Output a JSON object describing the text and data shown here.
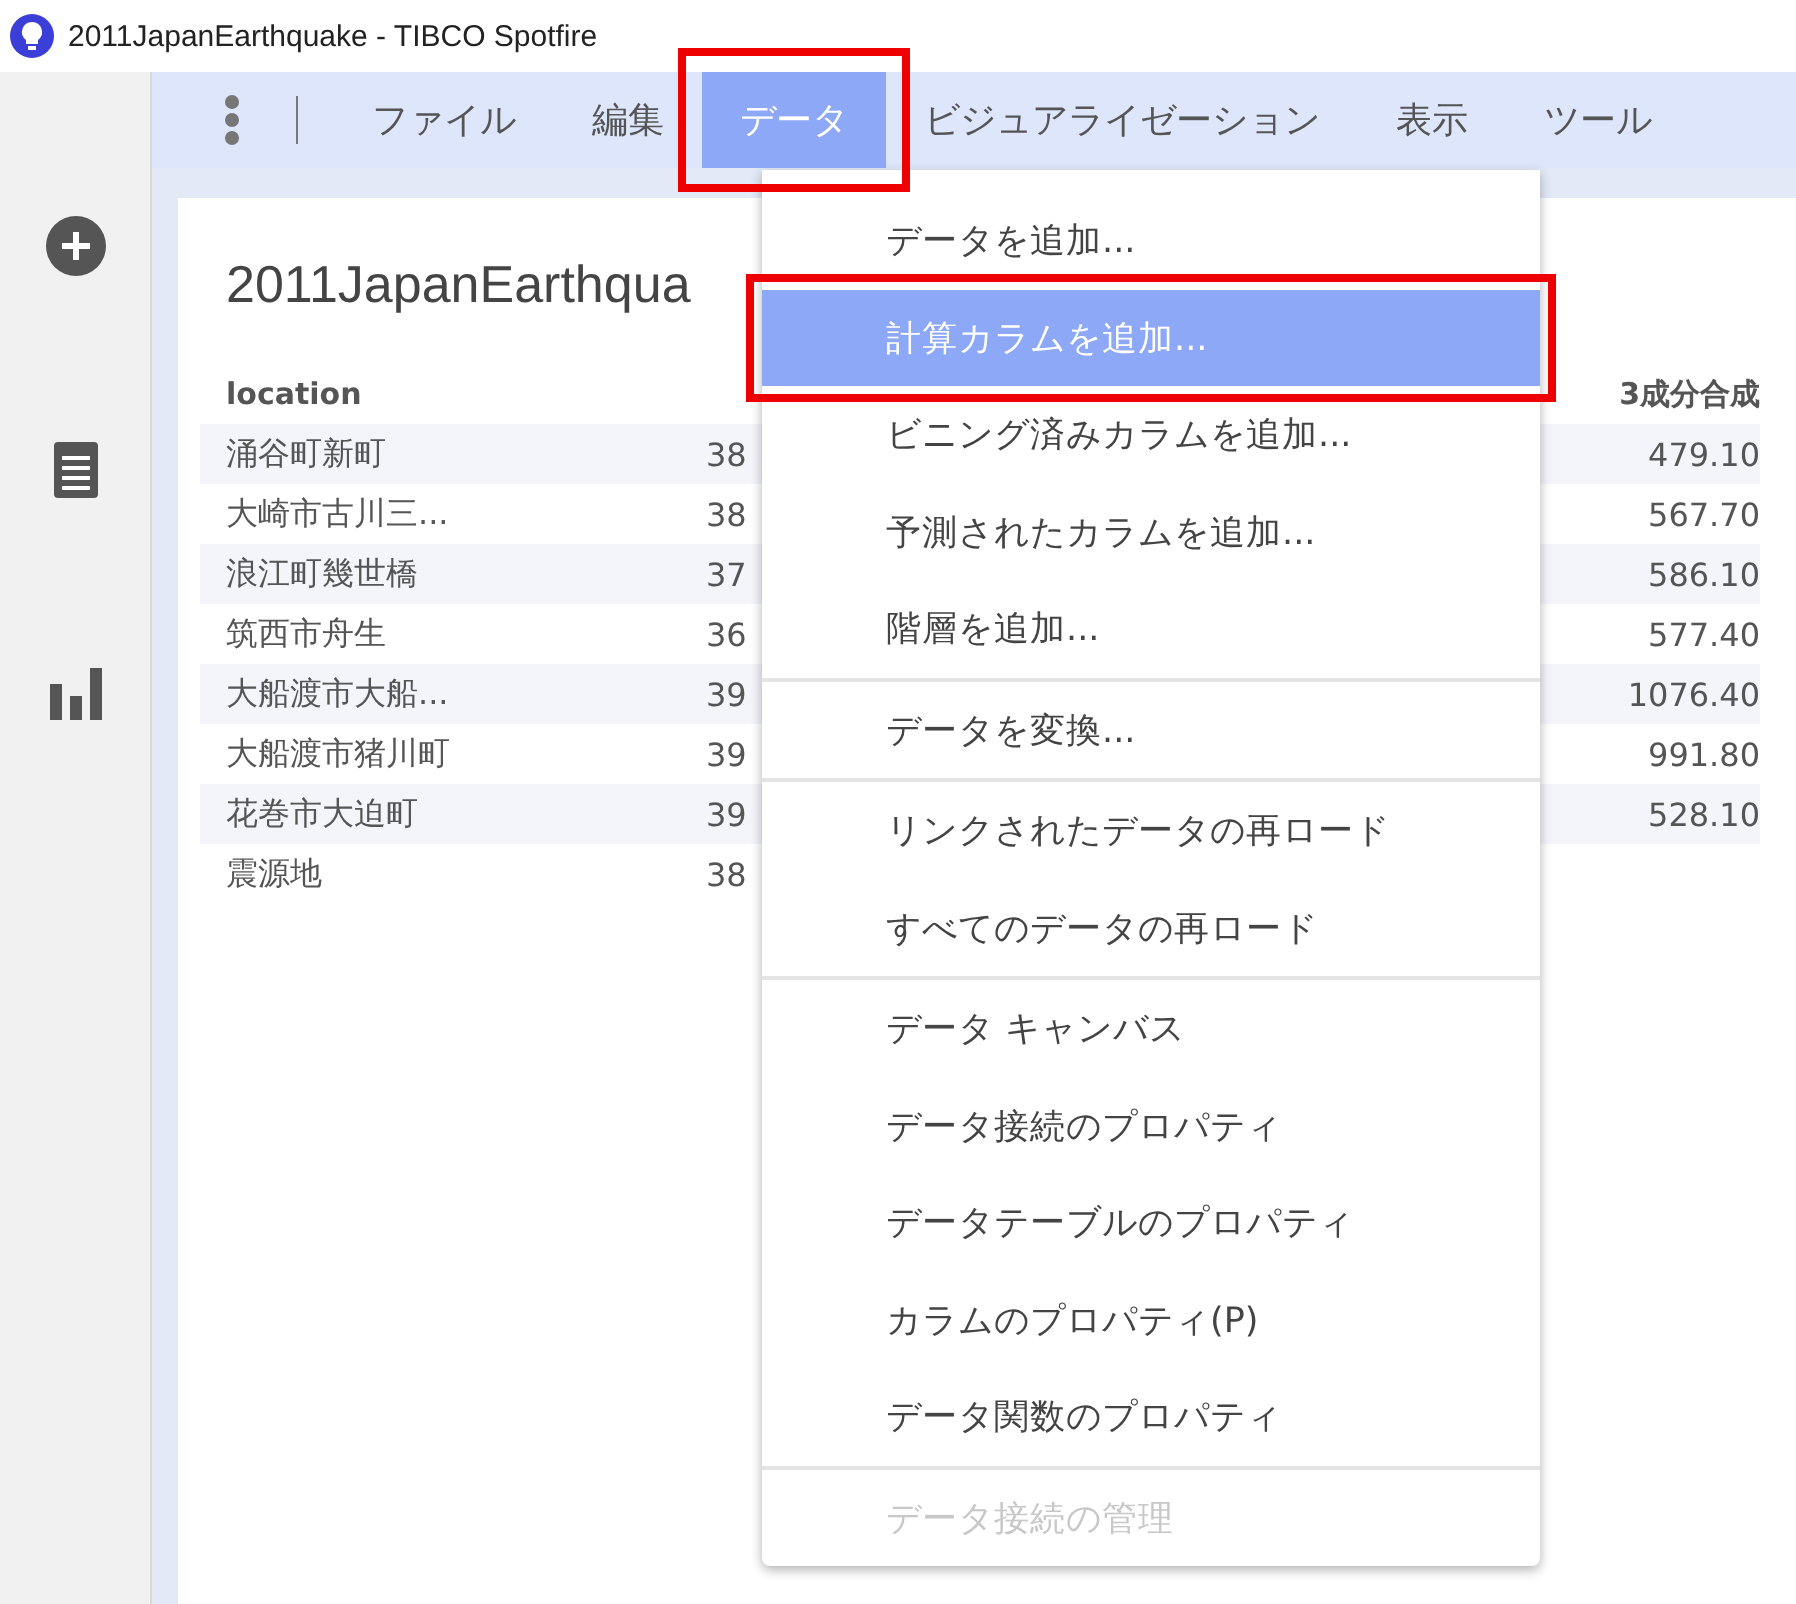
{
  "window": {
    "title": "2011JapanEarthquake - TIBCO Spotfire"
  },
  "menu_bar": [
    {
      "label": "ファイル",
      "selected": false,
      "highlighted": false
    },
    {
      "label": "編集",
      "selected": false,
      "highlighted": false
    },
    {
      "label": "データ",
      "selected": true,
      "highlighted": true
    },
    {
      "label": "ビジュアライゼーション",
      "selected": false,
      "highlighted": false
    },
    {
      "label": "表示",
      "selected": false,
      "highlighted": false
    },
    {
      "label": "ツール",
      "selected": false,
      "highlighted": false
    }
  ],
  "visualization": {
    "title": "2011JapanEarthqua",
    "columns": [
      "location",
      "3成分合成"
    ],
    "rows": [
      {
        "location": "涌谷町新町",
        "column_2": "38",
        "value": "479.10"
      },
      {
        "location": "大崎市古川三...",
        "column_2": "38",
        "value": "567.70"
      },
      {
        "location": "浪江町幾世橋",
        "column_2": "37",
        "value": "586.10"
      },
      {
        "location": "筑西市舟生",
        "column_2": "36",
        "value": "577.40"
      },
      {
        "location": "大船渡市大船...",
        "column_2": "39",
        "value": "1076.40"
      },
      {
        "location": "大船渡市猪川町",
        "column_2": "39",
        "value": "991.80"
      },
      {
        "location": "花巻市大迫町",
        "column_2": "39",
        "value": "528.10"
      },
      {
        "location": "震源地",
        "column_2": "38"
      }
    ]
  },
  "dropdown_menu": [
    [
      {
        "label": "データを追加...",
        "selected": false,
        "highlighted": false,
        "disabled": false
      },
      {
        "label": "計算カラムを追加...",
        "selected": true,
        "highlighted": true,
        "disabled": false
      },
      {
        "label": "ビニング済みカラムを追加...",
        "selected": false,
        "highlighted": false,
        "disabled": false
      },
      {
        "label": "予測されたカラムを追加...",
        "selected": false,
        "highlighted": false,
        "disabled": false
      },
      {
        "label": "階層を追加...",
        "selected": false,
        "highlighted": false,
        "disabled": false
      }
    ],
    [
      {
        "label": "データを変換...",
        "selected": false,
        "highlighted": false,
        "disabled": false
      }
    ],
    [
      {
        "label": "リンクされたデータの再ロード",
        "selected": false,
        "highlighted": false,
        "disabled": false
      },
      {
        "label": "すべてのデータの再ロード",
        "selected": false,
        "highlighted": false,
        "disabled": false
      }
    ],
    [
      {
        "label": "データ キャンバス",
        "selected": false,
        "highlighted": false,
        "disabled": false
      },
      {
        "label": "データ接続のプロパティ",
        "selected": false,
        "highlighted": false,
        "disabled": false
      },
      {
        "label": "データテーブルのプロパティ",
        "selected": false,
        "highlighted": false,
        "disabled": false
      },
      {
        "label": "カラムのプロパティ(P)",
        "selected": false,
        "highlighted": false,
        "disabled": false
      },
      {
        "label": "データ関数のプロパティ",
        "selected": false,
        "highlighted": false,
        "disabled": false
      }
    ],
    [
      {
        "label": "データ接続の管理",
        "selected": false,
        "highlighted": false,
        "disabled": true
      }
    ]
  ]
}
